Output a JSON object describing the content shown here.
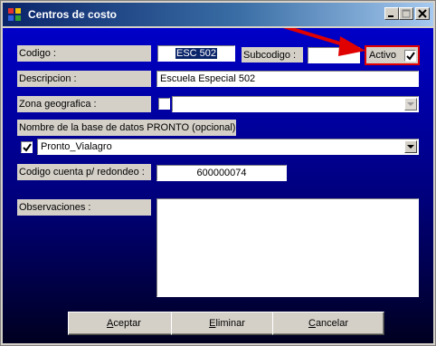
{
  "window": {
    "title": "Centros de costo",
    "controls": [
      "minimize",
      "maximize",
      "close"
    ]
  },
  "form": {
    "codigo_label": "Codigo :",
    "codigo_value": "ESC 502",
    "subcodigo_label": "Subcodigo :",
    "subcodigo_value": "",
    "activo_label": "Activo",
    "activo_checked": true,
    "descripcion_label": "Descripcion :",
    "descripcion_value": "Escuela Especial 502",
    "zona_label": "Zona geografica :",
    "zona_checked": false,
    "zona_value": "",
    "base_label": "Nombre de la base de datos PRONTO (opcional) :",
    "base_checked": true,
    "base_value": "Pronto_Vialagro",
    "cuenta_label": "Codigo cuenta p/ redondeo :",
    "cuenta_value": "600000074",
    "observaciones_label": "Observaciones :",
    "observaciones_value": ""
  },
  "buttons": {
    "aceptar_mnemonic": "A",
    "aceptar_rest": "ceptar",
    "eliminar_mnemonic": "E",
    "eliminar_rest": "liminar",
    "cancelar_mnemonic": "C",
    "cancelar_rest": "ancelar"
  },
  "colors": {
    "titlebar": "#0a246a",
    "annotation": "#e00000",
    "background": "#0000c8"
  },
  "icons": {
    "app": "app-icon",
    "check": "checkmark-icon",
    "dropdown": "chevron-down-icon"
  }
}
